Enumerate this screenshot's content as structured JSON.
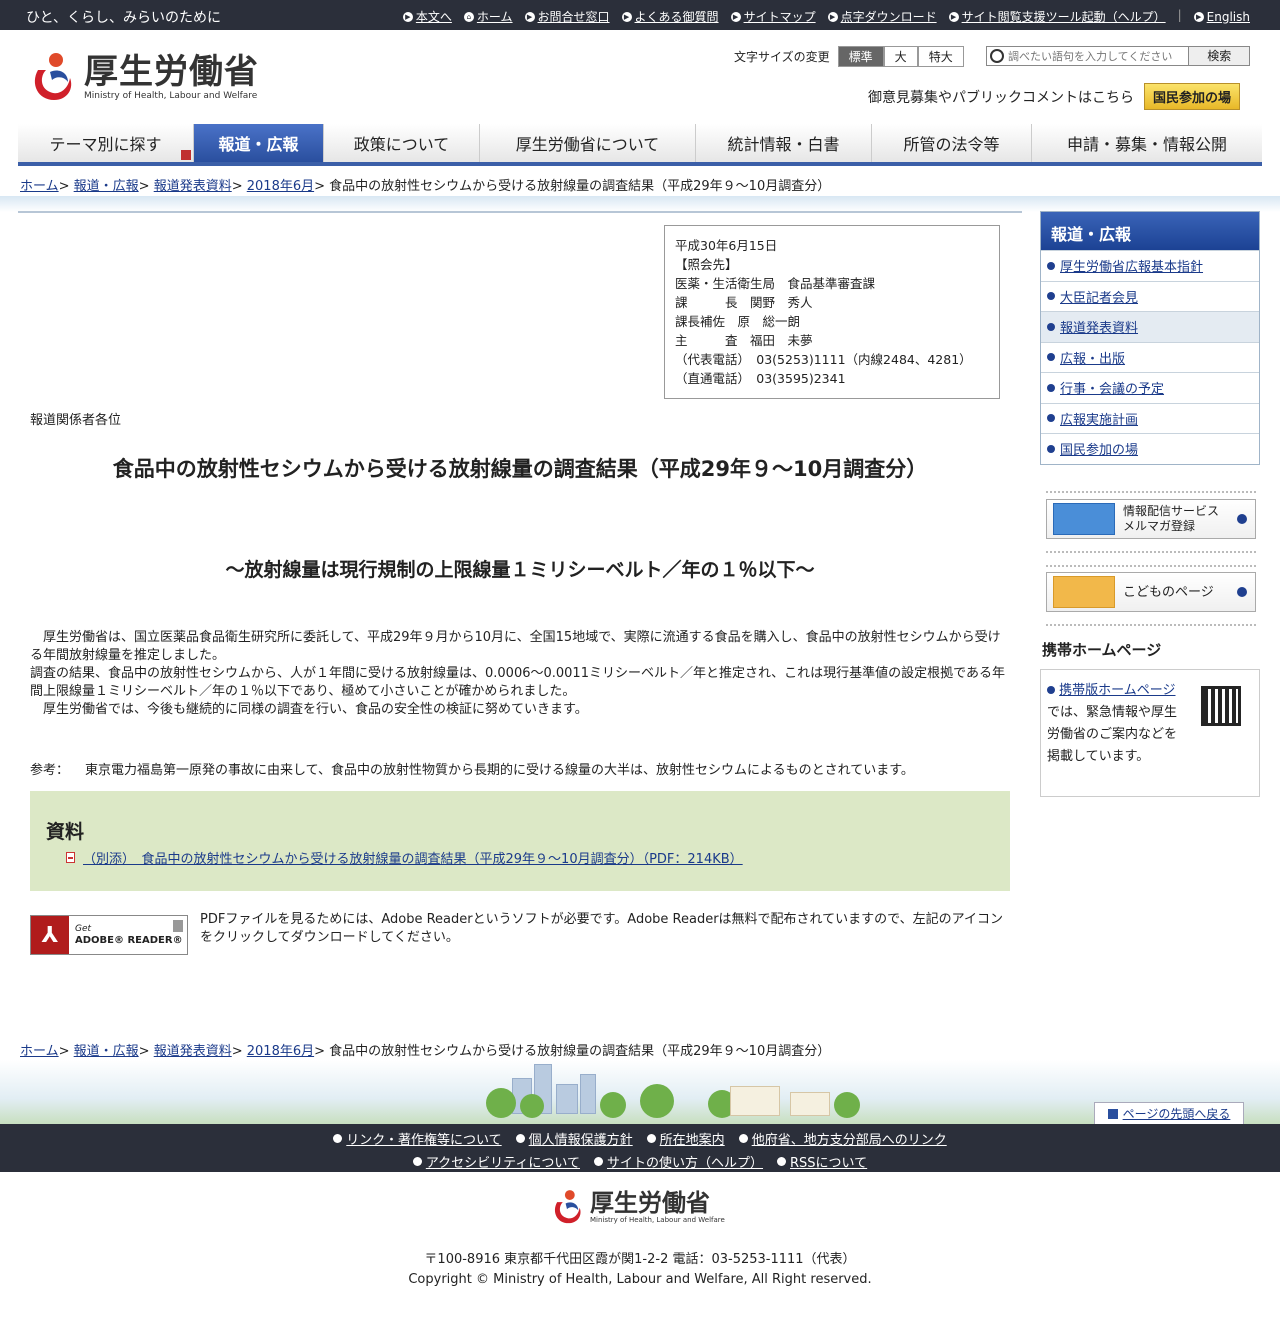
{
  "topbar": {
    "tagline": "ひと、くらし、みらいのために",
    "links": [
      "本文へ",
      "ホーム",
      "お問合せ窓口",
      "よくある御質問",
      "サイトマップ",
      "点字ダウンロード",
      "サイト閲覧支援ツール起動（ヘルプ）",
      "English"
    ]
  },
  "header": {
    "logo_jp": "厚生労働省",
    "logo_en": "Ministry of Health, Labour and Welfare",
    "fontsize_label": "文字サイズの変更",
    "fontsize_options": [
      "標準",
      "大",
      "特大"
    ],
    "search_placeholder": "調べたい語句を入力してください",
    "search_button": "検索",
    "public_comment": "御意見募集やパブリックコメントはこちら",
    "public_button": "国民参加の場"
  },
  "nav": [
    "テーマ別に探す",
    "報道・広報",
    "政策について",
    "厚生労働省について",
    "統計情報・白書",
    "所管の法令等",
    "申請・募集・情報公開"
  ],
  "breadcrumb": {
    "items": [
      "ホーム",
      "報道・広報",
      "報道発表資料",
      "2018年6月"
    ],
    "current": "食品中の放射性セシウムから受ける放射線量の調査結果（平成29年９～10月調査分）"
  },
  "contact": {
    "lines": [
      "平成30年6月15日",
      "【照会先】",
      "医薬・生活衛生局　食品基準審査課",
      "課　　　長　関野　秀人",
      "課長補佐　原　総一朗",
      "主　　　査　福田　未夢",
      "（代表電話）　03(5253)1111（内線2484、4281）",
      "（直通電話）　03(3595)2341"
    ]
  },
  "article": {
    "greeting": "報道関係者各位",
    "title": "食品中の放射性セシウムから受ける放射線量の調査結果（平成29年９～10月調査分）",
    "subtitle": "～放射線量は現行規制の上限線量１ミリシーベルト／年の１％以下～",
    "para1": "　厚生労働省は、国立医薬品食品衛生研究所に委託して、平成29年９月から10月に、全国15地域で、実際に流通する食品を購入し、食品中の放射性セシウムから受ける年間放射線量を推定しました。",
    "para2": "調査の結果、食品中の放射性セシウムから、人が１年間に受ける放射線量は、0.0006～0.0011ミリシーベルト／年と推定され、これは現行基準値の設定根拠である年間上限線量１ミリシーベルト／年の１％以下であり、極めて小さいことが確かめられました。",
    "para3": "　厚生労働省では、今後も継続的に同様の調査を行い、食品の安全性の検証に努めていきます。",
    "note_label": "参考：",
    "note_text": "東京電力福島第一原発の事故に由来して、食品中の放射性物質から長期的に受ける線量の大半は、放射性セシウムによるものとされています。",
    "shiryo_title": "資料",
    "shiryo_link": "（別添）　食品中の放射性セシウムから受ける放射線量の調査結果（平成29年９～10月調査分）（PDF：214KB）",
    "adobe_get": "Get",
    "adobe_reader": "ADOBE® READER®",
    "pdf_note": "PDFファイルを見るためには、Adobe Readerというソフトが必要です。Adobe Readerは無料で配布されていますので、左記のアイコンをクリックしてダウンロードしてください。"
  },
  "sidebar": {
    "heading": "報道・広報",
    "items": [
      "厚生労働省広報基本指針",
      "大臣記者会見",
      "報道発表資料",
      "広報・出版",
      "行事・会議の予定",
      "広報実施計画",
      "国民参加の場"
    ],
    "banner_mail_1": "情報配信サービス",
    "banner_mail_2": "メルマガ登録",
    "banner_kids": "こどものページ",
    "mobile_heading": "携帯ホームページ",
    "mobile_link": "携帯版ホームページ",
    "mobile_text": "では、緊急情報や厚生労働省のご案内などを掲載しています。"
  },
  "footer": {
    "totop": "ページの先頭へ戻る",
    "row1": [
      "リンク・著作権等について",
      "個人情報保護方針",
      "所在地案内",
      "他府省、地方支分部局へのリンク"
    ],
    "row2": [
      "アクセシビリティについて",
      "サイトの使い方（ヘルプ）",
      "RSSについて"
    ],
    "logo_jp": "厚生労働省",
    "logo_en": "Ministry of Health, Labour and Welfare",
    "address": "〒100-8916 東京都千代田区霞が関1-2-2 電話：03-5253-1111（代表）",
    "copyright": "Copyright © Ministry of Health, Labour and Welfare, All Right reserved."
  }
}
